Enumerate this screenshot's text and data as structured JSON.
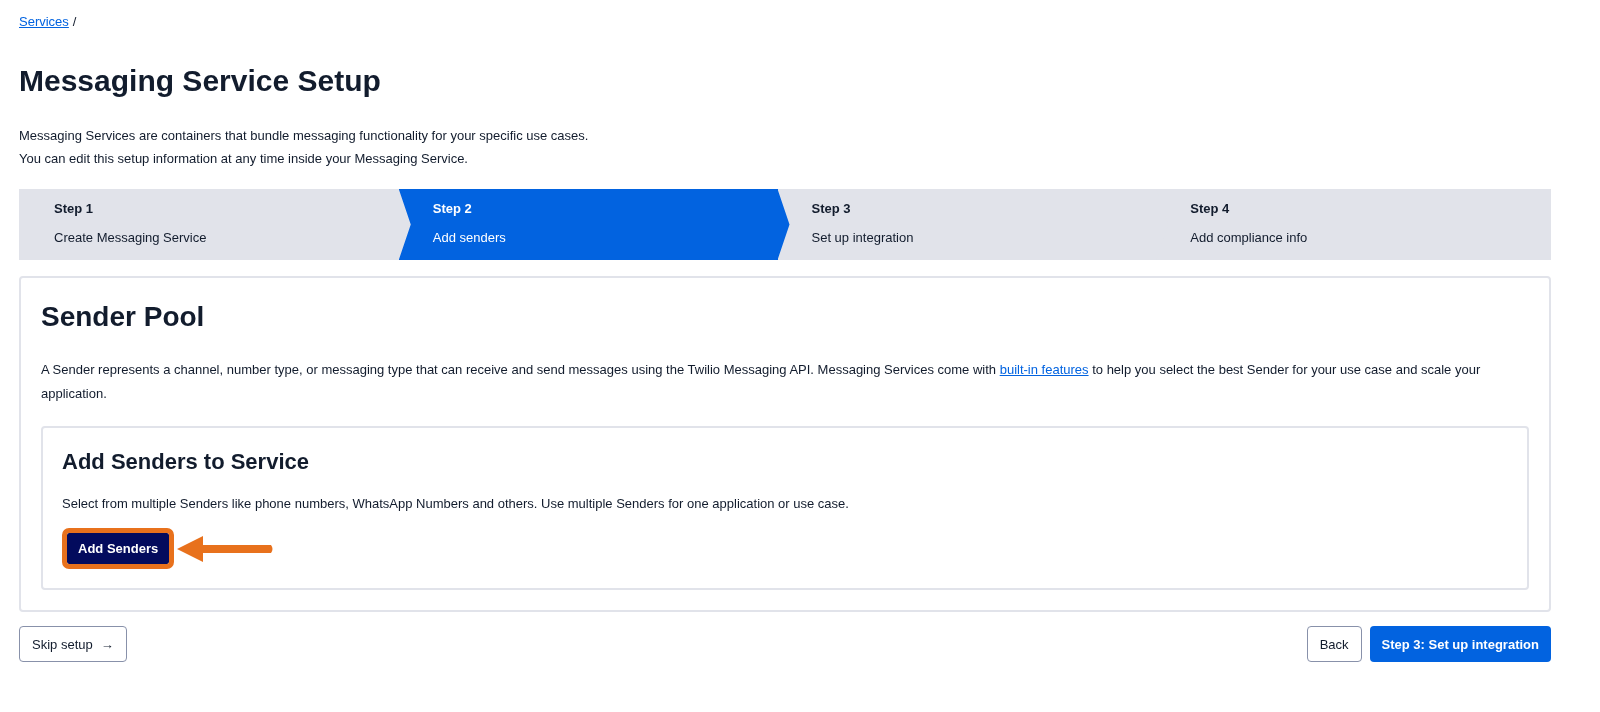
{
  "breadcrumb": {
    "link": "Services",
    "separator": "/"
  },
  "title": "Messaging Service Setup",
  "intro": [
    "Messaging Services are containers that bundle messaging functionality for your specific use cases.",
    "You can edit this setup information at any time inside your Messaging Service."
  ],
  "steps": [
    {
      "label": "Step 1",
      "name": "Create Messaging Service",
      "selected": false
    },
    {
      "label": "Step 2",
      "name": "Add senders",
      "selected": true
    },
    {
      "label": "Step 3",
      "name": "Set up integration",
      "selected": false
    },
    {
      "label": "Step 4",
      "name": "Add compliance info",
      "selected": false
    }
  ],
  "sender_pool": {
    "title": "Sender Pool",
    "description_before": "A Sender represents a channel, number type, or messaging type that can receive and send messages using the Twilio Messaging API. Messaging Services come with ",
    "description_link": "built-in features",
    "description_after": " to help you select the best Sender for your use case and scale your application.",
    "add_senders": {
      "title": "Add Senders to Service",
      "description": "Select from multiple Senders like phone numbers, WhatsApp Numbers and others. Use multiple Senders for one application or use case.",
      "button": "Add Senders",
      "highlighted": true
    }
  },
  "footer": {
    "skip": "Skip setup",
    "skip_arrow": "→",
    "back": "Back",
    "next": "Step 3: Set up integration"
  }
}
